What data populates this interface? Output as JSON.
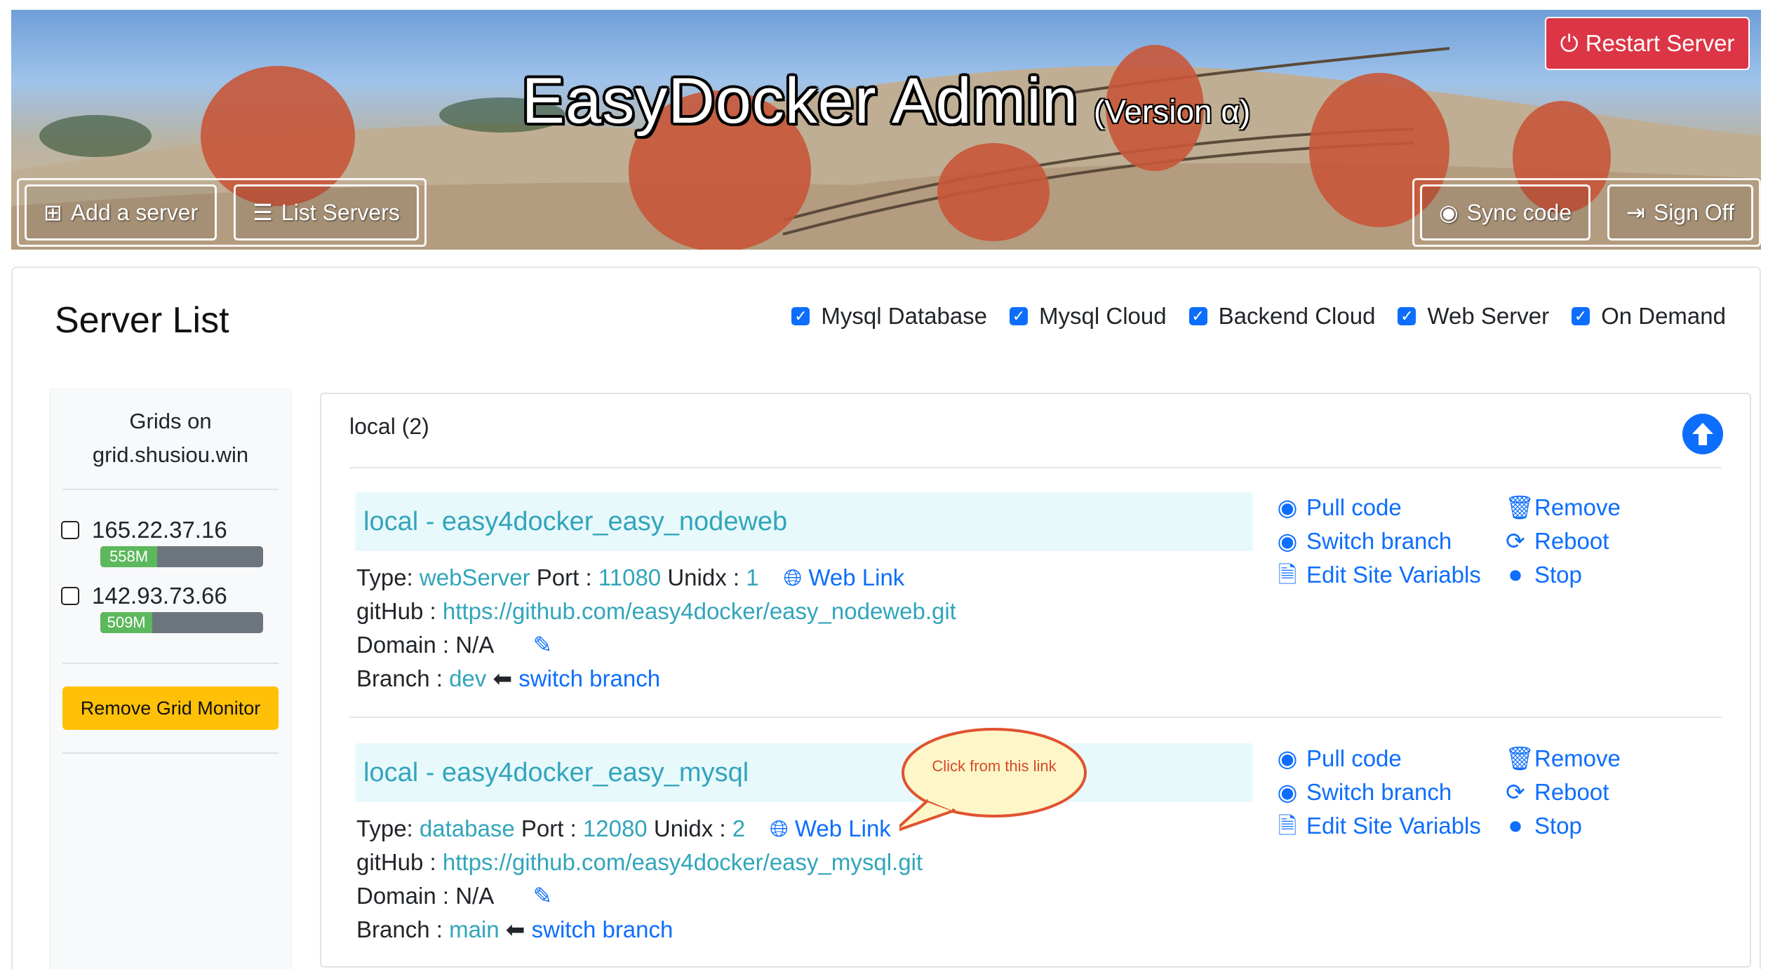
{
  "header": {
    "title": "EasyDocker Admin",
    "version": "(Version α)",
    "restart_label": "Restart Server",
    "left_buttons": [
      {
        "label": "Add a server",
        "icon": "plus-square-icon"
      },
      {
        "label": "List Servers",
        "icon": "list-icon"
      }
    ],
    "right_buttons": [
      {
        "label": "Sync code",
        "icon": "github-icon"
      },
      {
        "label": "Sign Off",
        "icon": "sign-out-icon"
      }
    ]
  },
  "page": {
    "title": "Server List",
    "filters": [
      {
        "label": "Mysql Database",
        "checked": true
      },
      {
        "label": "Mysql Cloud",
        "checked": true
      },
      {
        "label": "Backend Cloud",
        "checked": true
      },
      {
        "label": "Web Server",
        "checked": true
      },
      {
        "label": "On Demand",
        "checked": true
      }
    ]
  },
  "sidebar": {
    "title_line1": "Grids on",
    "title_line2": "grid.shusiou.win",
    "grids": [
      {
        "ip": "165.22.37.16",
        "usage_label": "558M",
        "usage_fraction": 0.35,
        "checked": false
      },
      {
        "ip": "142.93.73.66",
        "usage_label": "509M",
        "usage_fraction": 0.32,
        "checked": false
      }
    ],
    "remove_label": "Remove Grid Monitor"
  },
  "panel": {
    "heading": "local (2)",
    "servers": [
      {
        "title": "local - easy4docker_easy_nodeweb",
        "type_label": "Type:",
        "type": "webServer",
        "port_label": "Port :",
        "port": "11080",
        "unidx_label": "Unidx :",
        "unidx": "1",
        "web_link": "Web Link",
        "github_label": "gitHub :",
        "github": "https://github.com/easy4docker/easy_nodeweb.git",
        "domain_label": "Domain : N/A",
        "branch_label": "Branch :",
        "branch": "dev",
        "switch_label": "switch branch"
      },
      {
        "title": "local - easy4docker_easy_mysql",
        "type_label": "Type:",
        "type": "database",
        "port_label": "Port :",
        "port": "12080",
        "unidx_label": "Unidx :",
        "unidx": "2",
        "web_link": "Web Link",
        "github_label": "gitHub :",
        "github": "https://github.com/easy4docker/easy_mysql.git",
        "domain_label": "Domain : N/A",
        "branch_label": "Branch :",
        "branch": "main",
        "switch_label": "switch branch"
      }
    ],
    "actions": {
      "pull": "Pull code",
      "remove": "Remove",
      "switch": "Switch branch",
      "reboot": "Reboot",
      "edit": "Edit Site Variabls",
      "stop": "Stop"
    }
  },
  "annotation": {
    "callout_text": "Click from this link"
  },
  "colors": {
    "primary": "#0d6efd",
    "teal": "#31a5bb",
    "danger": "#dc3545",
    "warning": "#ffc107",
    "success": "#5cb85c"
  }
}
